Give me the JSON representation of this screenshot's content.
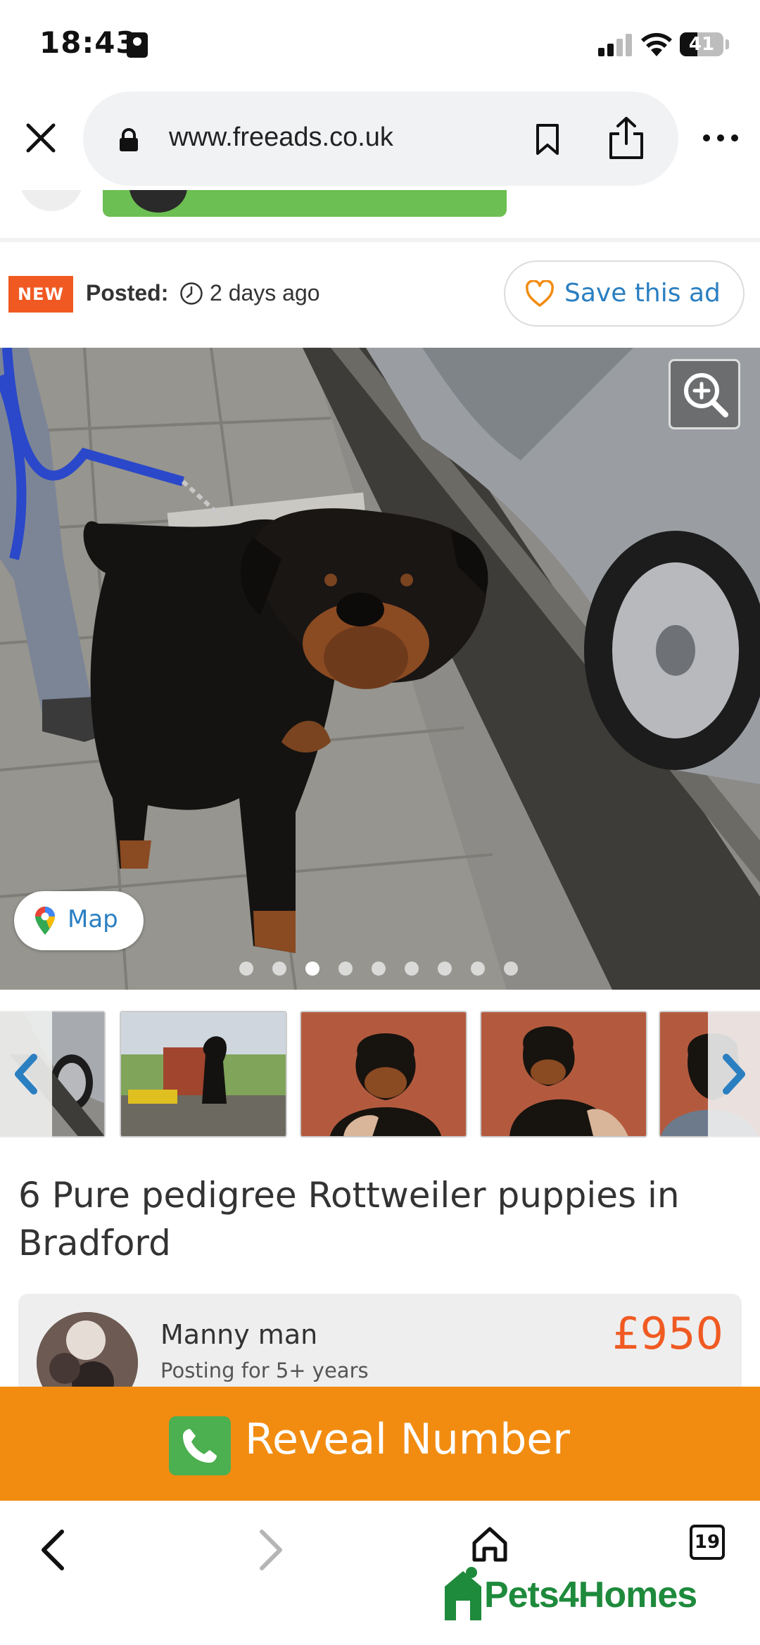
{
  "status_bar": {
    "time": "18:43",
    "battery": "41"
  },
  "browser": {
    "url": "www.freeads.co.uk",
    "tab_count": "19"
  },
  "listing_meta": {
    "badge": "NEW",
    "posted_label": "Posted:",
    "posted_value": "2 days ago",
    "save_label": "Save this ad"
  },
  "gallery": {
    "map_label": "Map",
    "dot_count": 9,
    "active_dot": 2
  },
  "listing": {
    "title": "6 Pure pedigree Rottweiler puppies in Bradford",
    "seller_name": "Manny man",
    "seller_sub": "Posting for 5+ years",
    "price": "£950"
  },
  "cta": {
    "reveal_label": "Reveal Number"
  },
  "ad_logo": {
    "text": "Pets4Homes"
  },
  "colors": {
    "accent_orange": "#f05a22",
    "reveal_orange": "#f28c11",
    "link_blue": "#2a7fc1",
    "logo_green": "#1e8a3c"
  }
}
